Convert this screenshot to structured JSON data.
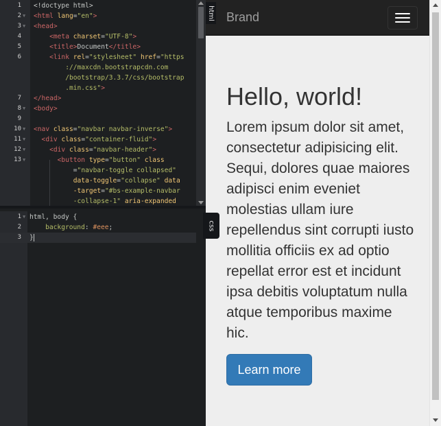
{
  "html_editor": {
    "tab_label": "html",
    "lines": [
      {
        "n": "1",
        "fold": false,
        "tokens": [
          {
            "t": "<!doctype html>",
            "c": "plain"
          }
        ]
      },
      {
        "n": "2",
        "fold": true,
        "tokens": [
          {
            "t": "<html ",
            "c": "tag"
          },
          {
            "t": "lang",
            "c": "attr"
          },
          {
            "t": "=",
            "c": "plain"
          },
          {
            "t": "\"en\"",
            "c": "str"
          },
          {
            "t": ">",
            "c": "tag"
          }
        ]
      },
      {
        "n": "3",
        "fold": true,
        "tokens": [
          {
            "t": "<head>",
            "c": "tag"
          }
        ]
      },
      {
        "n": "4",
        "fold": false,
        "tokens": [
          {
            "t": "    <meta ",
            "c": "tag"
          },
          {
            "t": "charset",
            "c": "attr"
          },
          {
            "t": "=",
            "c": "plain"
          },
          {
            "t": "\"UTF-8\"",
            "c": "str"
          },
          {
            "t": ">",
            "c": "tag"
          }
        ]
      },
      {
        "n": "5",
        "fold": false,
        "tokens": [
          {
            "t": "    <title>",
            "c": "tag"
          },
          {
            "t": "Document",
            "c": "plain"
          },
          {
            "t": "</title>",
            "c": "tag"
          }
        ]
      },
      {
        "n": "6",
        "fold": false,
        "tokens": [
          {
            "t": "    <link ",
            "c": "tag"
          },
          {
            "t": "rel",
            "c": "attr"
          },
          {
            "t": "=",
            "c": "plain"
          },
          {
            "t": "\"stylesheet\"",
            "c": "str"
          },
          {
            "t": " href",
            "c": "attr"
          },
          {
            "t": "=",
            "c": "plain"
          },
          {
            "t": "\"https",
            "c": "str"
          }
        ]
      },
      {
        "n": "",
        "fold": false,
        "tokens": [
          {
            "t": "        ://maxcdn.bootstrapcdn.com",
            "c": "str"
          }
        ]
      },
      {
        "n": "",
        "fold": false,
        "tokens": [
          {
            "t": "        /bootstrap/3.3.7/css/bootstrap",
            "c": "str"
          }
        ]
      },
      {
        "n": "",
        "fold": false,
        "tokens": [
          {
            "t": "        .min.css\"",
            "c": "str"
          },
          {
            "t": ">",
            "c": "tag"
          }
        ]
      },
      {
        "n": "7",
        "fold": false,
        "tokens": [
          {
            "t": "</head>",
            "c": "tag"
          }
        ]
      },
      {
        "n": "8",
        "fold": true,
        "tokens": [
          {
            "t": "<body>",
            "c": "tag"
          }
        ]
      },
      {
        "n": "9",
        "fold": false,
        "tokens": [
          {
            "t": "",
            "c": "plain"
          }
        ]
      },
      {
        "n": "10",
        "fold": true,
        "tokens": [
          {
            "t": "<nav ",
            "c": "tag"
          },
          {
            "t": "class",
            "c": "attr"
          },
          {
            "t": "=",
            "c": "plain"
          },
          {
            "t": "\"navbar navbar-inverse\"",
            "c": "str"
          },
          {
            "t": ">",
            "c": "tag"
          }
        ]
      },
      {
        "n": "11",
        "fold": true,
        "tokens": [
          {
            "t": "  <div ",
            "c": "tag"
          },
          {
            "t": "class",
            "c": "attr"
          },
          {
            "t": "=",
            "c": "plain"
          },
          {
            "t": "\"container-fluid\"",
            "c": "str"
          },
          {
            "t": ">",
            "c": "tag"
          }
        ]
      },
      {
        "n": "12",
        "fold": true,
        "tokens": [
          {
            "t": "    <div ",
            "c": "tag"
          },
          {
            "t": "class",
            "c": "attr"
          },
          {
            "t": "=",
            "c": "plain"
          },
          {
            "t": "\"navbar-header\"",
            "c": "str"
          },
          {
            "t": ">",
            "c": "tag"
          }
        ]
      },
      {
        "n": "13",
        "fold": true,
        "tokens": [
          {
            "t": "      <button ",
            "c": "tag"
          },
          {
            "t": "type",
            "c": "attr"
          },
          {
            "t": "=",
            "c": "plain"
          },
          {
            "t": "\"button\"",
            "c": "str"
          },
          {
            "t": " class",
            "c": "attr"
          }
        ]
      },
      {
        "n": "",
        "fold": false,
        "tokens": [
          {
            "t": "          =",
            "c": "plain"
          },
          {
            "t": "\"navbar-toggle collapsed\"",
            "c": "str"
          }
        ]
      },
      {
        "n": "",
        "fold": false,
        "tokens": [
          {
            "t": "          data-toggle",
            "c": "attr"
          },
          {
            "t": "=",
            "c": "plain"
          },
          {
            "t": "\"collapse\"",
            "c": "str"
          },
          {
            "t": " data",
            "c": "attr"
          }
        ]
      },
      {
        "n": "",
        "fold": false,
        "tokens": [
          {
            "t": "          -target",
            "c": "attr"
          },
          {
            "t": "=",
            "c": "plain"
          },
          {
            "t": "\"#bs-example-navbar",
            "c": "str"
          }
        ]
      },
      {
        "n": "",
        "fold": false,
        "tokens": [
          {
            "t": "          -collapse-1\"",
            "c": "str"
          },
          {
            "t": " aria-expanded",
            "c": "attr"
          }
        ]
      }
    ]
  },
  "css_editor": {
    "tab_label": "css",
    "lines": [
      {
        "n": "1",
        "fold": true,
        "tokens": [
          {
            "t": "html, body ",
            "c": "plain"
          },
          {
            "t": "{",
            "c": "brace"
          }
        ]
      },
      {
        "n": "2",
        "fold": false,
        "tokens": [
          {
            "t": "    background",
            "c": "prop"
          },
          {
            "t": ": ",
            "c": "plain"
          },
          {
            "t": "#eee",
            "c": "val"
          },
          {
            "t": ";",
            "c": "plain"
          }
        ]
      },
      {
        "n": "3",
        "fold": false,
        "tokens": [
          {
            "t": "}",
            "c": "brace"
          }
        ],
        "active": true
      }
    ]
  },
  "preview": {
    "navbar": {
      "brand": "Brand",
      "toggle_icon": "hamburger-icon"
    },
    "hero": {
      "title": "Hello, world!",
      "lead": "Lorem ipsum dolor sit amet, consectetur adipisicing elit. Sequi, dolores quae maiores adipisci enim eveniet molestias ullam iure repellendus sint corrupti iusto mollitia officiis ex ad optio repellat error est et incidunt ipsa debitis voluptatum nulla atque temporibus maxime hic.",
      "button": "Learn more"
    }
  },
  "colors": {
    "editor_bg": "#1d1f21",
    "gutter_bg": "#282a2e",
    "tag": "#cc6666",
    "attr": "#f0c674",
    "string": "#b5bd68",
    "value": "#de935f",
    "navbar_bg": "#222222",
    "primary": "#337ab7",
    "preview_bg": "#eeeeee"
  }
}
